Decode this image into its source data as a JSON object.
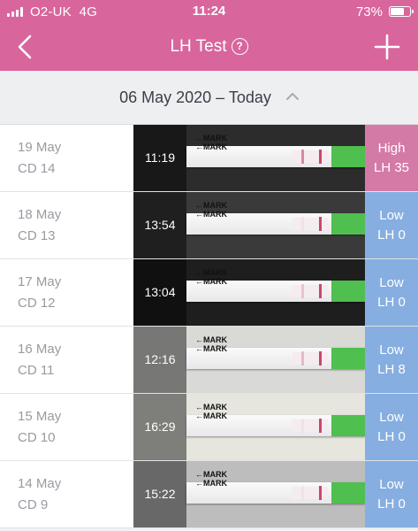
{
  "status": {
    "carrier": "O2-UK",
    "network": "4G",
    "time": "11:24",
    "battery": "73%",
    "battery_level": 0.73
  },
  "nav": {
    "title": "LH Test",
    "help": "?",
    "back_icon": "chevron-left-icon",
    "add_icon": "plus-icon"
  },
  "range": {
    "label": "06 May 2020 – Today",
    "toggle_icon": "chevron-up-icon"
  },
  "colors": {
    "header": "#d9659d",
    "high": "#d47aa6",
    "low": "#86aee0"
  },
  "tests": [
    {
      "day": "19 May",
      "cd": "CD 14",
      "time": "11:19",
      "level": "High",
      "lh": "LH 35",
      "strip": "MARK",
      "photo_bg": "#2c2c2c",
      "test_line": 0.6
    },
    {
      "day": "18 May",
      "cd": "CD 13",
      "time": "13:54",
      "level": "Low",
      "lh": "LH 0",
      "strip": "MARK",
      "photo_bg": "#3a3a3a",
      "test_line": 0
    },
    {
      "day": "17 May",
      "cd": "CD 12",
      "time": "13:04",
      "level": "Low",
      "lh": "LH 0",
      "strip": "MARK",
      "photo_bg": "#1e1e1e",
      "test_line": 0.25
    },
    {
      "day": "16 May",
      "cd": "CD 11",
      "time": "12:16",
      "level": "Low",
      "lh": "LH 8",
      "strip": "MARK",
      "photo_bg": "#d9d9d6",
      "test_line": 0.3
    },
    {
      "day": "15 May",
      "cd": "CD 10",
      "time": "16:29",
      "level": "Low",
      "lh": "LH 0",
      "strip": "MARK",
      "photo_bg": "#e6e6df",
      "test_line": 0
    },
    {
      "day": "14 May",
      "cd": "CD 9",
      "time": "15:22",
      "level": "Low",
      "lh": "LH 0",
      "strip": "MARK",
      "photo_bg": "#bdbdbd",
      "test_line": 0
    }
  ]
}
